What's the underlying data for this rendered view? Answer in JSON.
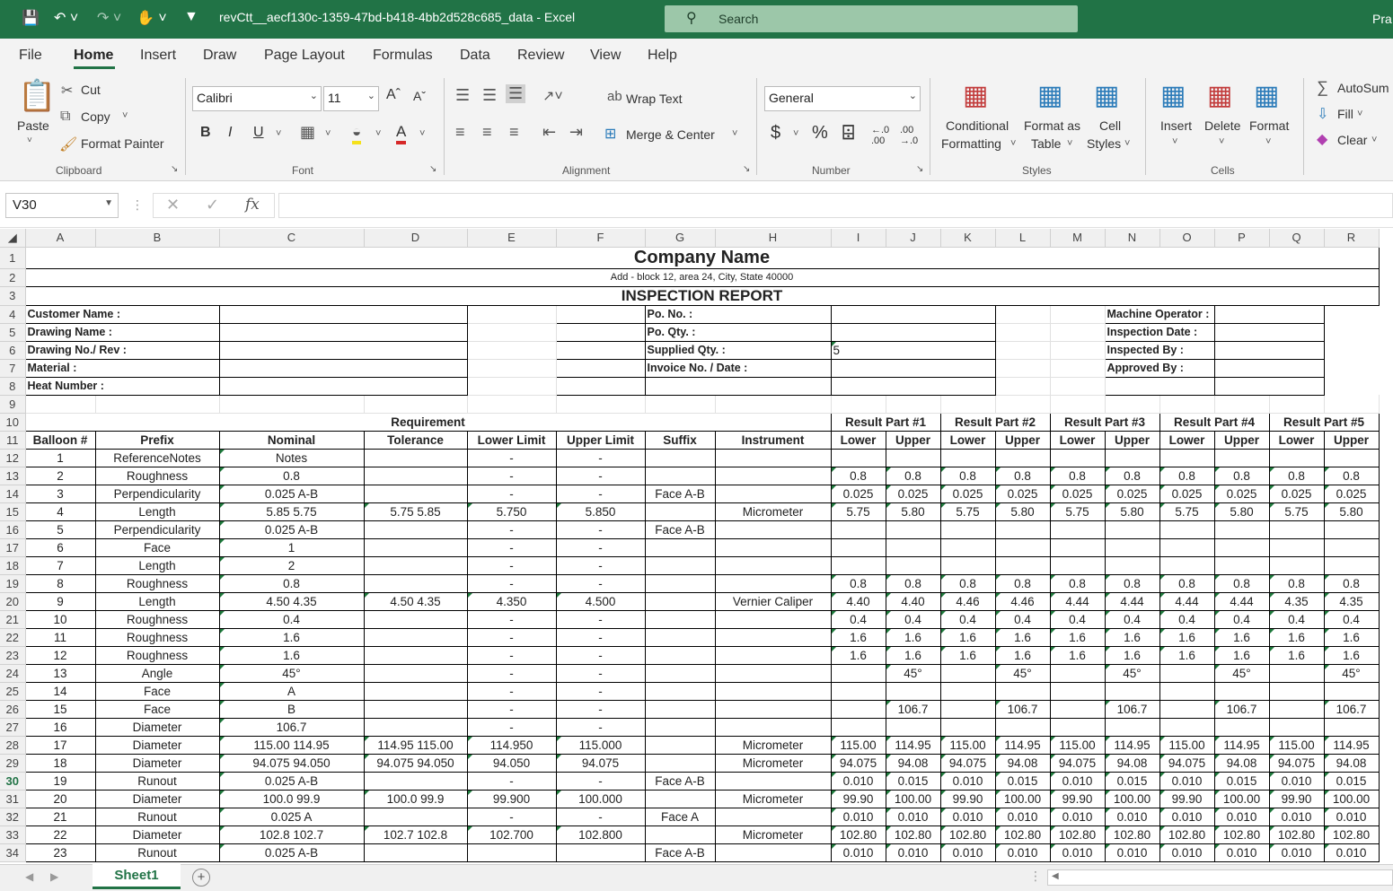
{
  "window": {
    "filename": "revCtt__aecf130c-1359-47bd-b418-4bb2d528c685_data  -  Excel",
    "search_placeholder": "Search",
    "user": "Pra"
  },
  "menu": {
    "tabs": [
      "File",
      "Home",
      "Insert",
      "Draw",
      "Page Layout",
      "Formulas",
      "Data",
      "Review",
      "View",
      "Help"
    ]
  },
  "ribbon": {
    "paste": "Paste",
    "cut": "Cut",
    "copy": "Copy",
    "format_painter": "Format Painter",
    "clipboard": "Clipboard",
    "font_name": "Calibri",
    "font_size": "11",
    "font": "Font",
    "wrap_text": "Wrap Text",
    "merge_center": "Merge & Center",
    "alignment": "Alignment",
    "number_format": "General",
    "number": "Number",
    "conditional_formatting_1": "Conditional",
    "conditional_formatting_2": "Formatting",
    "format_as_table_1": "Format as",
    "format_as_table_2": "Table",
    "cell_styles_1": "Cell",
    "cell_styles_2": "Styles",
    "styles": "Styles",
    "insert": "Insert",
    "delete": "Delete",
    "format": "Format",
    "cells": "Cells",
    "autosum": "AutoSum",
    "fill": "Fill",
    "clear": "Clear"
  },
  "formula_bar": {
    "name_box": "V30",
    "fx": "fx",
    "formula": ""
  },
  "sheet": {
    "columns": [
      "A",
      "B",
      "C",
      "D",
      "E",
      "F",
      "G",
      "H",
      "I",
      "J",
      "K",
      "L",
      "M",
      "N",
      "O",
      "P",
      "Q",
      "R"
    ],
    "company_name": "Company Name",
    "address": "Add - block 12, area 24, City, State 40000",
    "report_title": "INSPECTION REPORT",
    "info_labels": {
      "customer_name": "Customer Name :",
      "drawing_name": "Drawing Name :",
      "drawing_no": "Drawing No./ Rev :",
      "material": "Material :",
      "heat_number": "Heat Number :",
      "po_no": "Po. No. :",
      "po_qty": "Po. Qty. :",
      "supplied_qty": "Supplied Qty. :",
      "supplied_qty_value": "5",
      "invoice": "Invoice No. / Date :",
      "machine_operator": "Machine Operator :",
      "inspection_date": "Inspection Date :",
      "inspected_by": "Inspected By :",
      "approved_by": "Approved By :"
    },
    "requirement_header": "Requirement",
    "result_headers": [
      "Result Part #1",
      "Result Part #2",
      "Result Part #3",
      "Result Part #4",
      "Result Part #5"
    ],
    "column_headers": [
      "Balloon #",
      "Prefix",
      "Nominal",
      "Tolerance",
      "Lower Limit",
      "Upper Limit",
      "Suffix",
      "Instrument",
      "Lower",
      "Upper",
      "Lower",
      "Upper",
      "Lower",
      "Upper",
      "Lower",
      "Upper",
      "Lower",
      "Upper"
    ],
    "rows": [
      [
        "1",
        "ReferenceNotes",
        "Notes",
        "",
        "-",
        "-",
        "",
        "",
        "",
        "",
        "",
        "",
        "",
        "",
        "",
        "",
        "",
        ""
      ],
      [
        "2",
        "Roughness",
        "0.8",
        "",
        "-",
        "-",
        "",
        "",
        "0.8",
        "0.8",
        "0.8",
        "0.8",
        "0.8",
        "0.8",
        "0.8",
        "0.8",
        "0.8",
        "0.8"
      ],
      [
        "3",
        "Perpendicularity",
        "0.025 A-B",
        "",
        "-",
        "-",
        "Face A-B",
        "",
        "0.025",
        "0.025",
        "0.025",
        "0.025",
        "0.025",
        "0.025",
        "0.025",
        "0.025",
        "0.025",
        "0.025"
      ],
      [
        "4",
        "Length",
        "5.85 5.75",
        "5.75 5.85",
        "5.750",
        "5.850",
        "",
        "Micrometer",
        "5.75",
        "5.80",
        "5.75",
        "5.80",
        "5.75",
        "5.80",
        "5.75",
        "5.80",
        "5.75",
        "5.80"
      ],
      [
        "5",
        "Perpendicularity",
        "0.025 A-B",
        "",
        "-",
        "-",
        "Face A-B",
        "",
        "",
        "",
        "",
        "",
        "",
        "",
        "",
        "",
        "",
        ""
      ],
      [
        "6",
        "Face",
        "1",
        "",
        "-",
        "-",
        "",
        "",
        "",
        "",
        "",
        "",
        "",
        "",
        "",
        "",
        "",
        ""
      ],
      [
        "7",
        "Length",
        "2",
        "",
        "-",
        "-",
        "",
        "",
        "",
        "",
        "",
        "",
        "",
        "",
        "",
        "",
        "",
        ""
      ],
      [
        "8",
        "Roughness",
        "0.8",
        "",
        "-",
        "-",
        "",
        "",
        "0.8",
        "0.8",
        "0.8",
        "0.8",
        "0.8",
        "0.8",
        "0.8",
        "0.8",
        "0.8",
        "0.8"
      ],
      [
        "9",
        "Length",
        "4.50 4.35",
        "4.50 4.35",
        "4.350",
        "4.500",
        "",
        "Vernier Caliper",
        "4.40",
        "4.40",
        "4.46",
        "4.46",
        "4.44",
        "4.44",
        "4.44",
        "4.44",
        "4.35",
        "4.35"
      ],
      [
        "10",
        "Roughness",
        "0.4",
        "",
        "-",
        "-",
        "",
        "",
        "0.4",
        "0.4",
        "0.4",
        "0.4",
        "0.4",
        "0.4",
        "0.4",
        "0.4",
        "0.4",
        "0.4"
      ],
      [
        "11",
        "Roughness",
        "1.6",
        "",
        "-",
        "-",
        "",
        "",
        "1.6",
        "1.6",
        "1.6",
        "1.6",
        "1.6",
        "1.6",
        "1.6",
        "1.6",
        "1.6",
        "1.6"
      ],
      [
        "12",
        "Roughness",
        "1.6",
        "",
        "-",
        "-",
        "",
        "",
        "1.6",
        "1.6",
        "1.6",
        "1.6",
        "1.6",
        "1.6",
        "1.6",
        "1.6",
        "1.6",
        "1.6"
      ],
      [
        "13",
        "Angle",
        "45°",
        "",
        "-",
        "-",
        "",
        "",
        "",
        "45°",
        "",
        "45°",
        "",
        "45°",
        "",
        "45°",
        "",
        "45°"
      ],
      [
        "14",
        "Face",
        "A",
        "",
        "-",
        "-",
        "",
        "",
        "",
        "",
        "",
        "",
        "",
        "",
        "",
        "",
        "",
        ""
      ],
      [
        "15",
        "Face",
        "B",
        "",
        "-",
        "-",
        "",
        "",
        "",
        "106.7",
        "",
        "106.7",
        "",
        "106.7",
        "",
        "106.7",
        "",
        "106.7"
      ],
      [
        "16",
        "Diameter",
        "106.7",
        "",
        "-",
        "-",
        "",
        "",
        "",
        "",
        "",
        "",
        "",
        "",
        "",
        "",
        "",
        ""
      ],
      [
        "17",
        "Diameter",
        "115.00 114.95",
        "114.95 115.00",
        "114.950",
        "115.000",
        "",
        "Micrometer",
        "115.00",
        "114.95",
        "115.00",
        "114.95",
        "115.00",
        "114.95",
        "115.00",
        "114.95",
        "115.00",
        "114.95"
      ],
      [
        "18",
        "Diameter",
        "94.075 94.050",
        "94.075 94.050",
        "94.050",
        "94.075",
        "",
        "Micrometer",
        "94.075",
        "94.08",
        "94.075",
        "94.08",
        "94.075",
        "94.08",
        "94.075",
        "94.08",
        "94.075",
        "94.08"
      ],
      [
        "19",
        "Runout",
        "0.025 A-B",
        "",
        "-",
        "-",
        "Face A-B",
        "",
        "0.010",
        "0.015",
        "0.010",
        "0.015",
        "0.010",
        "0.015",
        "0.010",
        "0.015",
        "0.010",
        "0.015"
      ],
      [
        "20",
        "Diameter",
        "100.0 99.9",
        "100.0 99.9",
        "99.900",
        "100.000",
        "",
        "Micrometer",
        "99.90",
        "100.00",
        "99.90",
        "100.00",
        "99.90",
        "100.00",
        "99.90",
        "100.00",
        "99.90",
        "100.00"
      ],
      [
        "21",
        "Runout",
        "0.025 A",
        "",
        "-",
        "-",
        "Face A",
        "",
        "0.010",
        "0.010",
        "0.010",
        "0.010",
        "0.010",
        "0.010",
        "0.010",
        "0.010",
        "0.010",
        "0.010"
      ],
      [
        "22",
        "Diameter",
        "102.8 102.7",
        "102.7 102.8",
        "102.700",
        "102.800",
        "",
        "Micrometer",
        "102.80",
        "102.80",
        "102.80",
        "102.80",
        "102.80",
        "102.80",
        "102.80",
        "102.80",
        "102.80",
        "102.80"
      ],
      [
        "23",
        "Runout",
        "0.025 A-B",
        "",
        "",
        "",
        "Face A-B",
        "",
        "0.010",
        "0.010",
        "0.010",
        "0.010",
        "0.010",
        "0.010",
        "0.010",
        "0.010",
        "0.010",
        "0.010"
      ]
    ],
    "row_numbers": [
      "1",
      "2",
      "3",
      "4",
      "5",
      "6",
      "7",
      "8",
      "9",
      "10",
      "11",
      "12",
      "13",
      "14",
      "15",
      "16",
      "17",
      "18",
      "19",
      "20",
      "21",
      "22",
      "23",
      "24",
      "25",
      "26",
      "27",
      "28",
      "29",
      "30",
      "31",
      "32",
      "33",
      "34"
    ],
    "selected_row": "30",
    "sheet_tab": "Sheet1",
    "add_sheet": "+"
  }
}
